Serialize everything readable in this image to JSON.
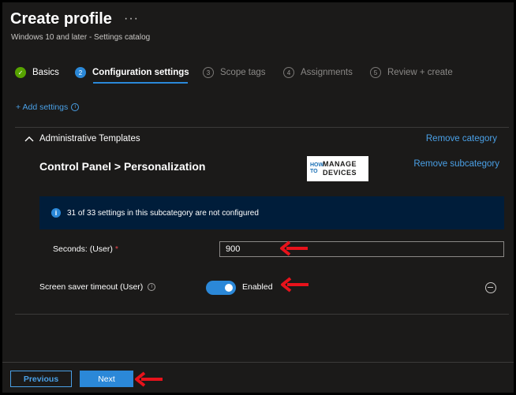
{
  "header": {
    "title": "Create profile",
    "more": "···",
    "subtitle": "Windows 10 and later - Settings catalog"
  },
  "steps": [
    {
      "number": "✓",
      "label": "Basics",
      "state": "done"
    },
    {
      "number": "2",
      "label": "Configuration settings",
      "state": "current"
    },
    {
      "number": "3",
      "label": "Scope tags",
      "state": "future"
    },
    {
      "number": "4",
      "label": "Assignments",
      "state": "future"
    },
    {
      "number": "5",
      "label": "Review + create",
      "state": "future"
    }
  ],
  "add_settings": {
    "label": "+ Add settings",
    "info": "i"
  },
  "category": {
    "title": "Administrative Templates",
    "remove_label": "Remove category",
    "subcategory_title": "Control Panel > Personalization",
    "remove_sub_label": "Remove subcategory"
  },
  "logo": {
    "how": "HOW TO",
    "manage": "MANAGE",
    "devices": "DEVICES"
  },
  "info_bar": {
    "icon": "i",
    "text": "31 of 33 settings in this subcategory are not configured"
  },
  "seconds_field": {
    "label": "Seconds: (User)",
    "required": "*",
    "value": "900"
  },
  "screen_saver": {
    "label": "Screen saver timeout (User)",
    "info": "i",
    "state": "Enabled",
    "on": true
  },
  "footer": {
    "previous_label": "Previous",
    "next_label": "Next"
  },
  "colors": {
    "accent": "#2b88d8",
    "link": "#4aa0e6",
    "success": "#57a300",
    "annotation_arrow": "#e8121b"
  }
}
